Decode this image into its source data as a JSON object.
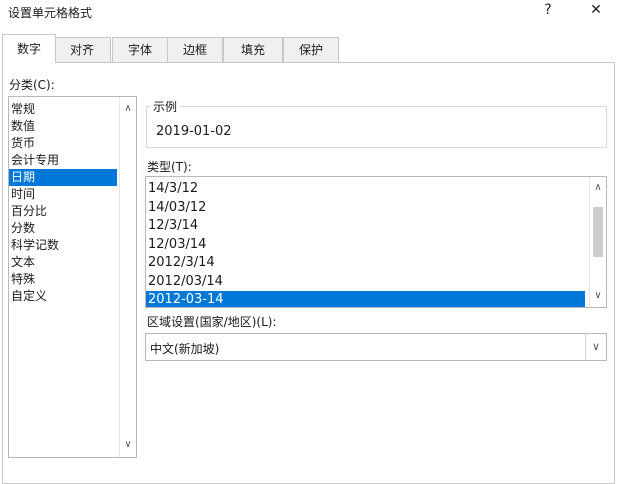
{
  "window": {
    "title": "设置单元格格式",
    "help": "?",
    "close": "✕"
  },
  "tabs": [
    {
      "label": "数字",
      "active": true
    },
    {
      "label": "对齐",
      "active": false
    },
    {
      "label": "字体",
      "active": false
    },
    {
      "label": "边框",
      "active": false
    },
    {
      "label": "填充",
      "active": false
    },
    {
      "label": "保护",
      "active": false
    }
  ],
  "category": {
    "label": "分类(C):",
    "items": [
      "常规",
      "数值",
      "货币",
      "会计专用",
      "日期",
      "时间",
      "百分比",
      "分数",
      "科学记数",
      "文本",
      "特殊",
      "自定义"
    ],
    "selected_index": 4
  },
  "sample": {
    "label": "示例",
    "value": "2019-01-02"
  },
  "type": {
    "label": "类型(T):",
    "items": [
      "14/3/12",
      "14/03/12",
      "12/3/14",
      "12/03/14",
      "2012/3/14",
      "2012/03/14",
      "2012-03-14"
    ],
    "selected_index": 6
  },
  "locale": {
    "label": "区域设置(国家/地区)(L):",
    "value": "中文(新加坡)"
  },
  "icons": {
    "up": "∧",
    "down": "∨"
  }
}
